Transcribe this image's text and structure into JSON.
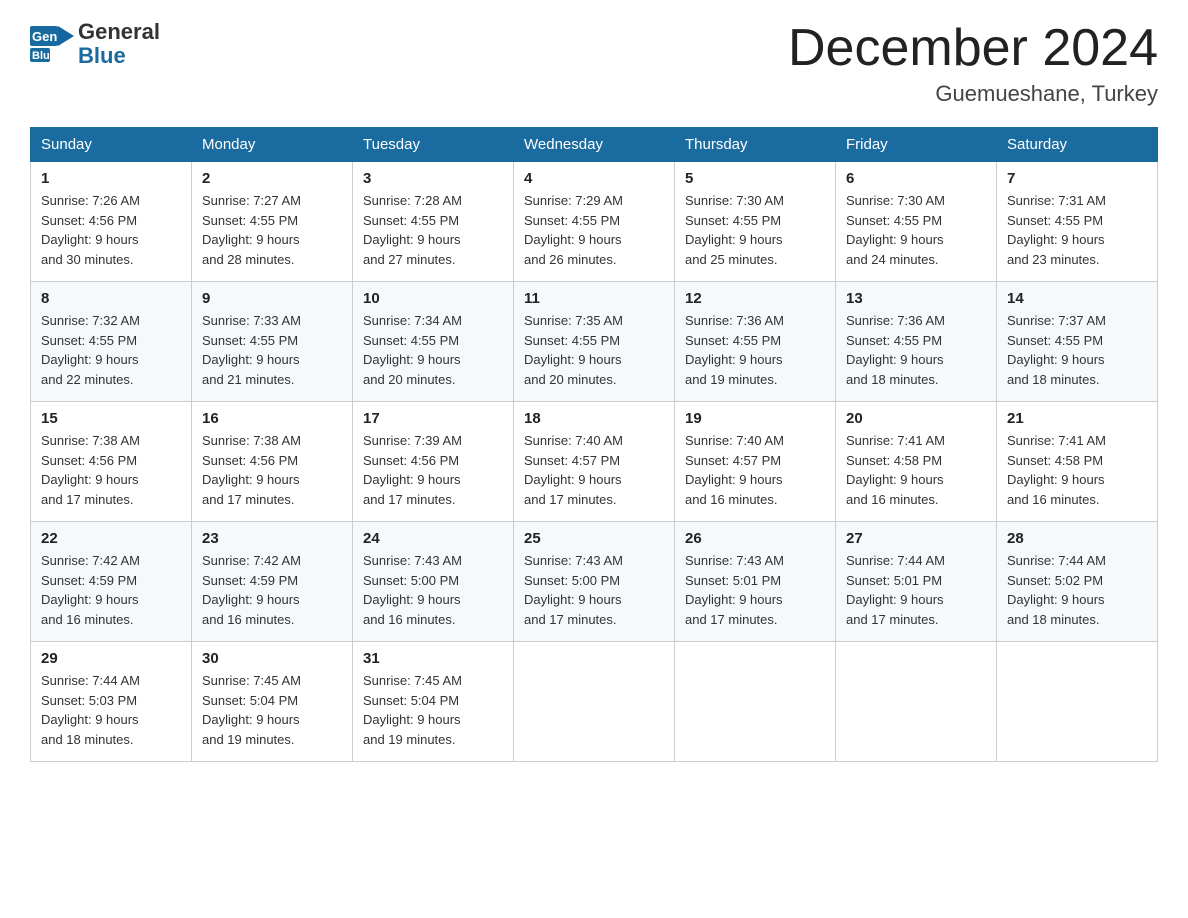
{
  "header": {
    "logo_general": "General",
    "logo_blue": "Blue",
    "title": "December 2024",
    "location": "Guemueshane, Turkey"
  },
  "days_of_week": [
    "Sunday",
    "Monday",
    "Tuesday",
    "Wednesday",
    "Thursday",
    "Friday",
    "Saturday"
  ],
  "weeks": [
    [
      {
        "day": "1",
        "sunrise": "7:26 AM",
        "sunset": "4:56 PM",
        "daylight": "9 hours and 30 minutes."
      },
      {
        "day": "2",
        "sunrise": "7:27 AM",
        "sunset": "4:55 PM",
        "daylight": "9 hours and 28 minutes."
      },
      {
        "day": "3",
        "sunrise": "7:28 AM",
        "sunset": "4:55 PM",
        "daylight": "9 hours and 27 minutes."
      },
      {
        "day": "4",
        "sunrise": "7:29 AM",
        "sunset": "4:55 PM",
        "daylight": "9 hours and 26 minutes."
      },
      {
        "day": "5",
        "sunrise": "7:30 AM",
        "sunset": "4:55 PM",
        "daylight": "9 hours and 25 minutes."
      },
      {
        "day": "6",
        "sunrise": "7:30 AM",
        "sunset": "4:55 PM",
        "daylight": "9 hours and 24 minutes."
      },
      {
        "day": "7",
        "sunrise": "7:31 AM",
        "sunset": "4:55 PM",
        "daylight": "9 hours and 23 minutes."
      }
    ],
    [
      {
        "day": "8",
        "sunrise": "7:32 AM",
        "sunset": "4:55 PM",
        "daylight": "9 hours and 22 minutes."
      },
      {
        "day": "9",
        "sunrise": "7:33 AM",
        "sunset": "4:55 PM",
        "daylight": "9 hours and 21 minutes."
      },
      {
        "day": "10",
        "sunrise": "7:34 AM",
        "sunset": "4:55 PM",
        "daylight": "9 hours and 20 minutes."
      },
      {
        "day": "11",
        "sunrise": "7:35 AM",
        "sunset": "4:55 PM",
        "daylight": "9 hours and 20 minutes."
      },
      {
        "day": "12",
        "sunrise": "7:36 AM",
        "sunset": "4:55 PM",
        "daylight": "9 hours and 19 minutes."
      },
      {
        "day": "13",
        "sunrise": "7:36 AM",
        "sunset": "4:55 PM",
        "daylight": "9 hours and 18 minutes."
      },
      {
        "day": "14",
        "sunrise": "7:37 AM",
        "sunset": "4:55 PM",
        "daylight": "9 hours and 18 minutes."
      }
    ],
    [
      {
        "day": "15",
        "sunrise": "7:38 AM",
        "sunset": "4:56 PM",
        "daylight": "9 hours and 17 minutes."
      },
      {
        "day": "16",
        "sunrise": "7:38 AM",
        "sunset": "4:56 PM",
        "daylight": "9 hours and 17 minutes."
      },
      {
        "day": "17",
        "sunrise": "7:39 AM",
        "sunset": "4:56 PM",
        "daylight": "9 hours and 17 minutes."
      },
      {
        "day": "18",
        "sunrise": "7:40 AM",
        "sunset": "4:57 PM",
        "daylight": "9 hours and 17 minutes."
      },
      {
        "day": "19",
        "sunrise": "7:40 AM",
        "sunset": "4:57 PM",
        "daylight": "9 hours and 16 minutes."
      },
      {
        "day": "20",
        "sunrise": "7:41 AM",
        "sunset": "4:58 PM",
        "daylight": "9 hours and 16 minutes."
      },
      {
        "day": "21",
        "sunrise": "7:41 AM",
        "sunset": "4:58 PM",
        "daylight": "9 hours and 16 minutes."
      }
    ],
    [
      {
        "day": "22",
        "sunrise": "7:42 AM",
        "sunset": "4:59 PM",
        "daylight": "9 hours and 16 minutes."
      },
      {
        "day": "23",
        "sunrise": "7:42 AM",
        "sunset": "4:59 PM",
        "daylight": "9 hours and 16 minutes."
      },
      {
        "day": "24",
        "sunrise": "7:43 AM",
        "sunset": "5:00 PM",
        "daylight": "9 hours and 16 minutes."
      },
      {
        "day": "25",
        "sunrise": "7:43 AM",
        "sunset": "5:00 PM",
        "daylight": "9 hours and 17 minutes."
      },
      {
        "day": "26",
        "sunrise": "7:43 AM",
        "sunset": "5:01 PM",
        "daylight": "9 hours and 17 minutes."
      },
      {
        "day": "27",
        "sunrise": "7:44 AM",
        "sunset": "5:01 PM",
        "daylight": "9 hours and 17 minutes."
      },
      {
        "day": "28",
        "sunrise": "7:44 AM",
        "sunset": "5:02 PM",
        "daylight": "9 hours and 18 minutes."
      }
    ],
    [
      {
        "day": "29",
        "sunrise": "7:44 AM",
        "sunset": "5:03 PM",
        "daylight": "9 hours and 18 minutes."
      },
      {
        "day": "30",
        "sunrise": "7:45 AM",
        "sunset": "5:04 PM",
        "daylight": "9 hours and 19 minutes."
      },
      {
        "day": "31",
        "sunrise": "7:45 AM",
        "sunset": "5:04 PM",
        "daylight": "9 hours and 19 minutes."
      },
      null,
      null,
      null,
      null
    ]
  ],
  "labels": {
    "sunrise": "Sunrise:",
    "sunset": "Sunset:",
    "daylight": "Daylight:"
  }
}
